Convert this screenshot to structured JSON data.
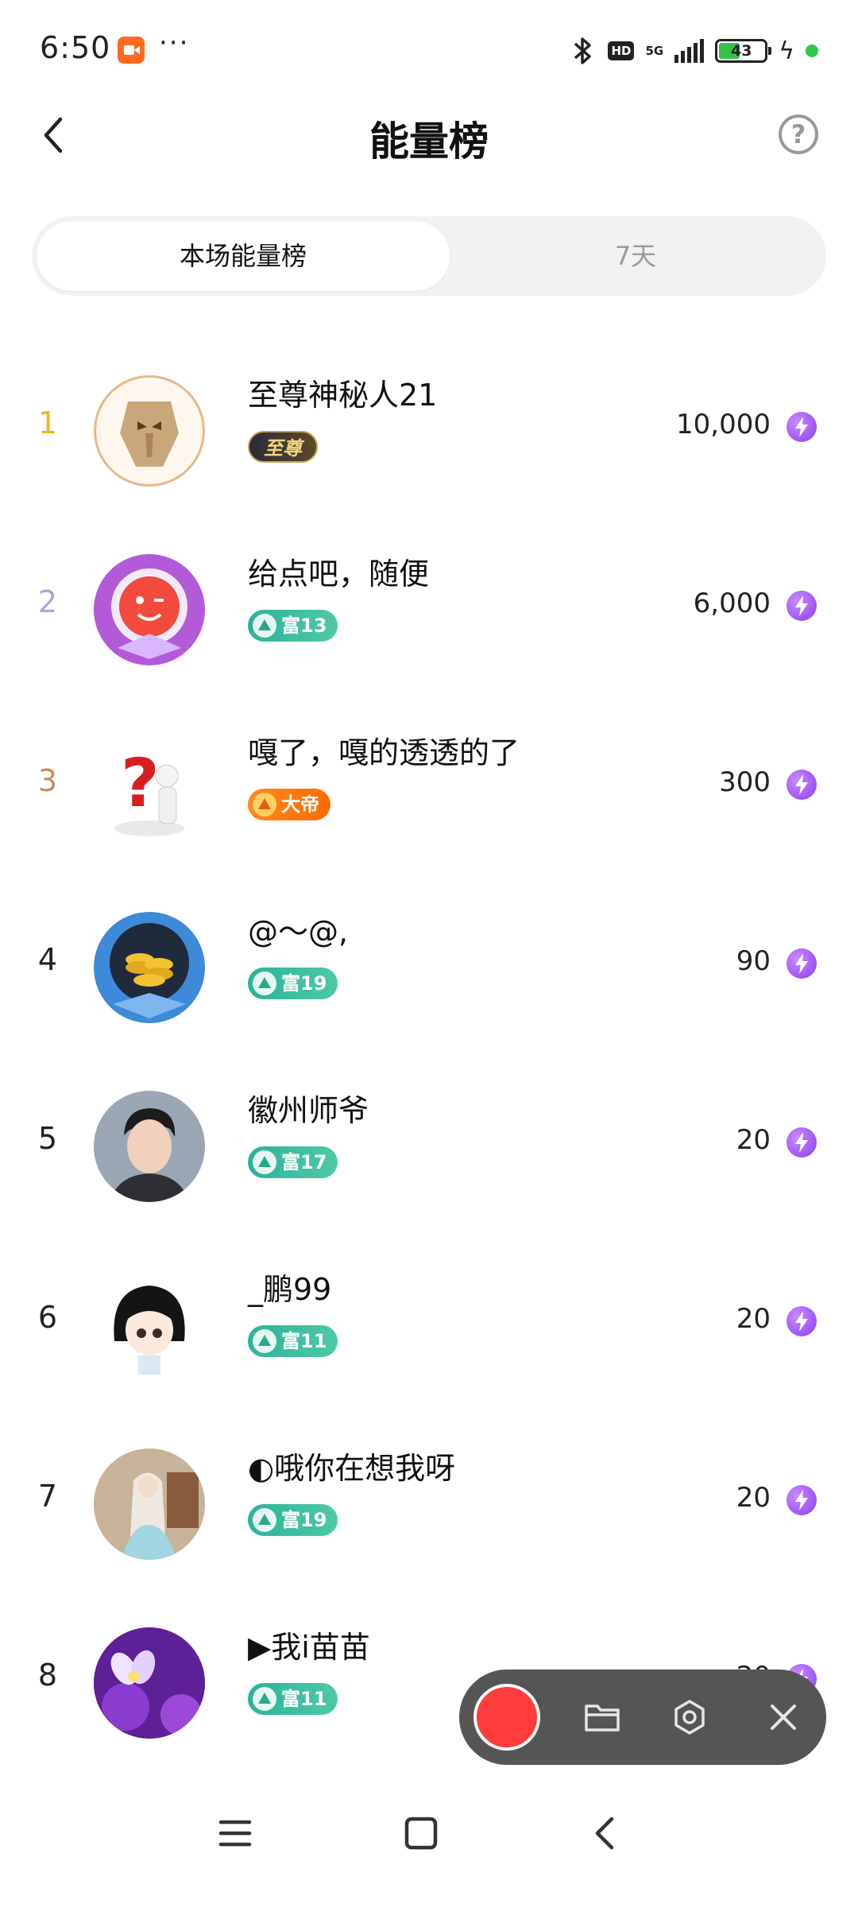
{
  "status_bar": {
    "time": "6:50",
    "dots": "···",
    "hd": "HD",
    "network": "5G",
    "battery": "43"
  },
  "header": {
    "title": "能量榜",
    "help_symbol": "?"
  },
  "tabs": [
    {
      "label": "本场能量榜",
      "active": true
    },
    {
      "label": "7天",
      "active": false
    }
  ],
  "rankings": [
    {
      "rank": "1",
      "name": "至尊神秘人21",
      "badge": "至尊",
      "badge_type": "supreme",
      "score": "10,000"
    },
    {
      "rank": "2",
      "name": "给点吧，随便",
      "badge": "富13",
      "badge_type": "rich",
      "score": "6,000"
    },
    {
      "rank": "3",
      "name": "嘎了，嘎的透透的了",
      "badge": "大帝",
      "badge_type": "emperor",
      "score": "300"
    },
    {
      "rank": "4",
      "name": "@～@,",
      "badge": "富19",
      "badge_type": "rich",
      "score": "90"
    },
    {
      "rank": "5",
      "name": "徽州师爷",
      "badge": "富17",
      "badge_type": "rich",
      "score": "20"
    },
    {
      "rank": "6",
      "name": "_鹏99",
      "badge": "富11",
      "badge_type": "rich",
      "score": "20"
    },
    {
      "rank": "7",
      "name": "◐哦你在想我呀",
      "badge": "富19",
      "badge_type": "rich",
      "score": "20"
    },
    {
      "rank": "8",
      "name": "▶我i苗苗",
      "badge": "富11",
      "badge_type": "rich",
      "score": "20"
    }
  ],
  "colors": {
    "rank_gold": "#eab622",
    "rank_silver": "#a9a6d8",
    "rank_bronze": "#c9895a",
    "energy_purple": "#8a3cf0",
    "recorder_red": "#ff3b3b"
  },
  "icons": {
    "energy": "lightning-bolt-icon",
    "back": "chevron-left-icon",
    "help": "question-circle-icon"
  }
}
